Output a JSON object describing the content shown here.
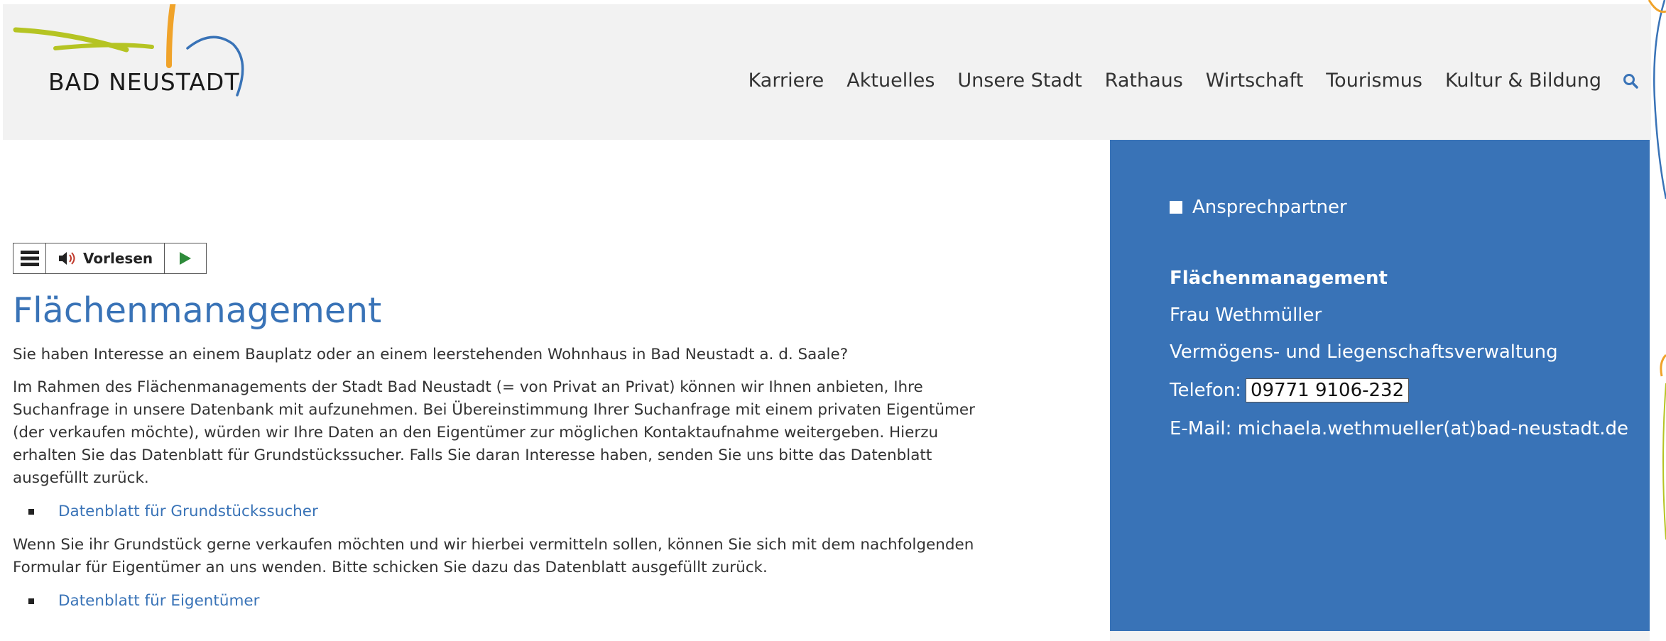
{
  "logo": {
    "text": "BAD NEUSTADT"
  },
  "nav": {
    "items": [
      "Karriere",
      "Aktuelles",
      "Unsere Stadt",
      "Rathaus",
      "Wirtschaft",
      "Tourismus",
      "Kultur & Bildung"
    ],
    "search_icon": "search-icon"
  },
  "readbar": {
    "read_label": "Vorlesen",
    "menu_icon": "hamburger-icon",
    "speaker_icon": "speaker-icon",
    "play_icon": "play-icon"
  },
  "main": {
    "title": "Flächenmanagement",
    "intro": "Sie haben Interesse an einem Bauplatz oder an einem leerstehenden Wohnhaus in Bad Neustadt a. d. Saale?",
    "para1": "Im Rahmen des Flächenmanagements der Stadt Bad Neustadt (= von Privat an Privat) können wir Ihnen anbieten, Ihre Suchanfrage in unsere Datenbank mit aufzunehmen. Bei Übereinstimmung Ihrer Suchanfrage mit einem privaten Eigentümer (der verkaufen möchte), würden wir Ihre Daten an den Eigentümer zur möglichen Kontaktaufnahme weitergeben. Hierzu erhalten Sie das Datenblatt für Grundstückssucher. Falls Sie daran Interesse haben, senden Sie uns bitte das Datenblatt ausgefüllt zurück.",
    "link1": "Datenblatt für Grundstückssucher",
    "para2": "Wenn Sie ihr Grundstück gerne verkaufen möchten und wir hierbei vermitteln sollen, können Sie sich mit dem nachfolgenden Formular für Eigentümer an uns wenden. Bitte schicken Sie dazu das Datenblatt ausgefüllt zurück.",
    "link2": "Datenblatt für Eigentümer"
  },
  "sidebar": {
    "section_label": "Ansprechpartner",
    "dept": "Flächenmanagement",
    "person": "Frau Wethmüller",
    "office": "Vermögens- und Liegenschaftsverwaltung",
    "phone_label": "Telefon:",
    "phone": "09771 9106-232",
    "email_line": "E-Mail: michaela.wethmueller(at)bad-neustadt.de"
  },
  "colors": {
    "accent_blue": "#3973b7",
    "logo_green": "#b5c423",
    "logo_orange": "#f0a32a",
    "header_bg": "#f2f2f2",
    "play_green": "#2e8b3a"
  }
}
